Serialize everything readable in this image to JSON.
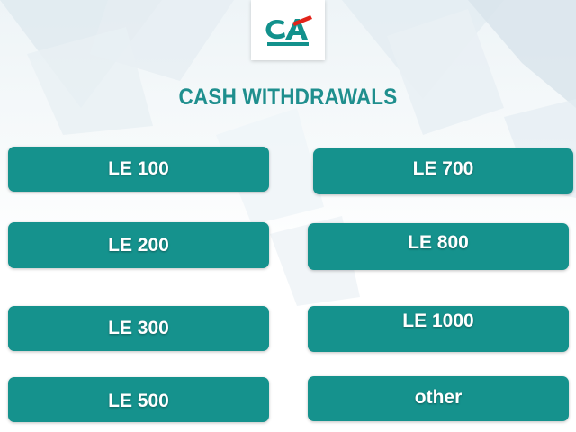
{
  "header": {
    "title": "CASH WITHDRAWALS"
  },
  "logo": {
    "icon": "credit-agricole-logo",
    "colors": {
      "teal": "#12918c",
      "red": "#e2231a"
    }
  },
  "buttons": {
    "le_100": "LE 100",
    "le_200": "LE 200",
    "le_300": "LE 300",
    "le_500": "LE 500",
    "le_700": "LE 700",
    "le_800": "LE 800",
    "le_1000": "LE 1000",
    "other": "other"
  },
  "colors": {
    "button_bg": "#15928d",
    "title": "#1f8f8e",
    "button_text": "#ffffff"
  }
}
